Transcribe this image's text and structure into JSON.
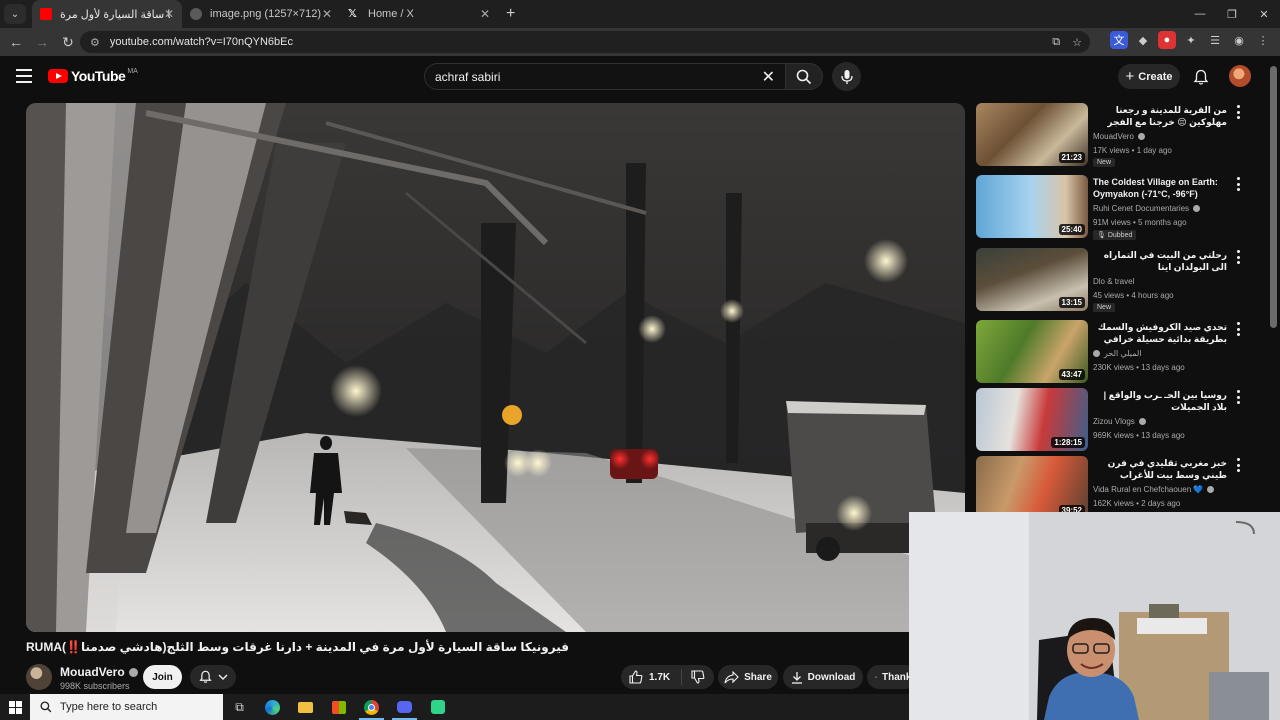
{
  "browser": {
    "tabs": [
      {
        "title": "فيرونيكا ساقة السيارة لأول مرة",
        "active": true
      },
      {
        "title": "image.png (1257×712)",
        "active": false
      },
      {
        "title": "Home / X",
        "active": false
      }
    ],
    "url": "youtube.com/watch?v=I70nQYN6bEc"
  },
  "header": {
    "logo_text": "YouTube",
    "country_code": "MA",
    "search_value": "achraf sabiri",
    "create_label": "Create"
  },
  "video": {
    "title": "فيرونيكا ساقة السيارة لأول مرة في المدينة + دارنا غرقات وسط الثلج(هادشي صدمنا‼️)",
    "title_suffix": "RUMA",
    "channel": "MouadVero",
    "subscribers": "998K subscribers",
    "join_label": "Join",
    "likes": "1.7K",
    "share_label": "Share",
    "download_label": "Download",
    "thanks_label": "Thanks"
  },
  "recommendations": [
    {
      "title": "من القرية للمدينة و رجعنا مهلوكين 😔 خرجنا مع الفجر حتى الليل و الخدمة ما سالاتش",
      "channel": "MouadVero",
      "verified": true,
      "meta": "17K views • 1 day ago",
      "duration": "21:23",
      "badge": "New",
      "rtl": true
    },
    {
      "title": "The Coldest Village on Earth: Oymyakon (-71°C, -96°F)",
      "channel": "Ruhi Cenet Documentaries",
      "verified": true,
      "meta": "91M views • 5 months ago",
      "duration": "25:40",
      "badge": "Dubbed",
      "rtl": false
    },
    {
      "title": "رحلتي من البيت في التماراه الى البولدان ايتا",
      "channel": "Dlo & travel",
      "verified": false,
      "meta": "45 views • 4 hours ago",
      "duration": "13:15",
      "badge": "New",
      "rtl": true
    },
    {
      "title": "تحدي صيد الكروفيش والسمك بطريقة بدائية حسيلة خرافي",
      "channel": "الميلي الحر",
      "verified": true,
      "meta": "230K views • 13 days ago",
      "duration": "43:47",
      "badge": "",
      "rtl": true
    },
    {
      "title": "روسيا بين الحـ ـرب والواقع | بلاد الجميلات",
      "channel": "Zizou Vlogs",
      "verified": true,
      "meta": "969K views • 13 days ago",
      "duration": "1:28:15",
      "badge": "",
      "rtl": true
    },
    {
      "title": "خبز مغربي تقليدي في فرن طيني وسط بيت للأغراب ومربي البرغال",
      "channel": "Vida Rural en Chefchaouen 💙",
      "verified": true,
      "meta": "162K views • 2 days ago",
      "duration": "39:52",
      "badge": "",
      "rtl": true
    }
  ],
  "taskbar": {
    "search_placeholder": "Type here to search"
  },
  "colors": {
    "youtube_red": "#ff0000",
    "background": "#0f0f0f",
    "pill": "#272727"
  }
}
